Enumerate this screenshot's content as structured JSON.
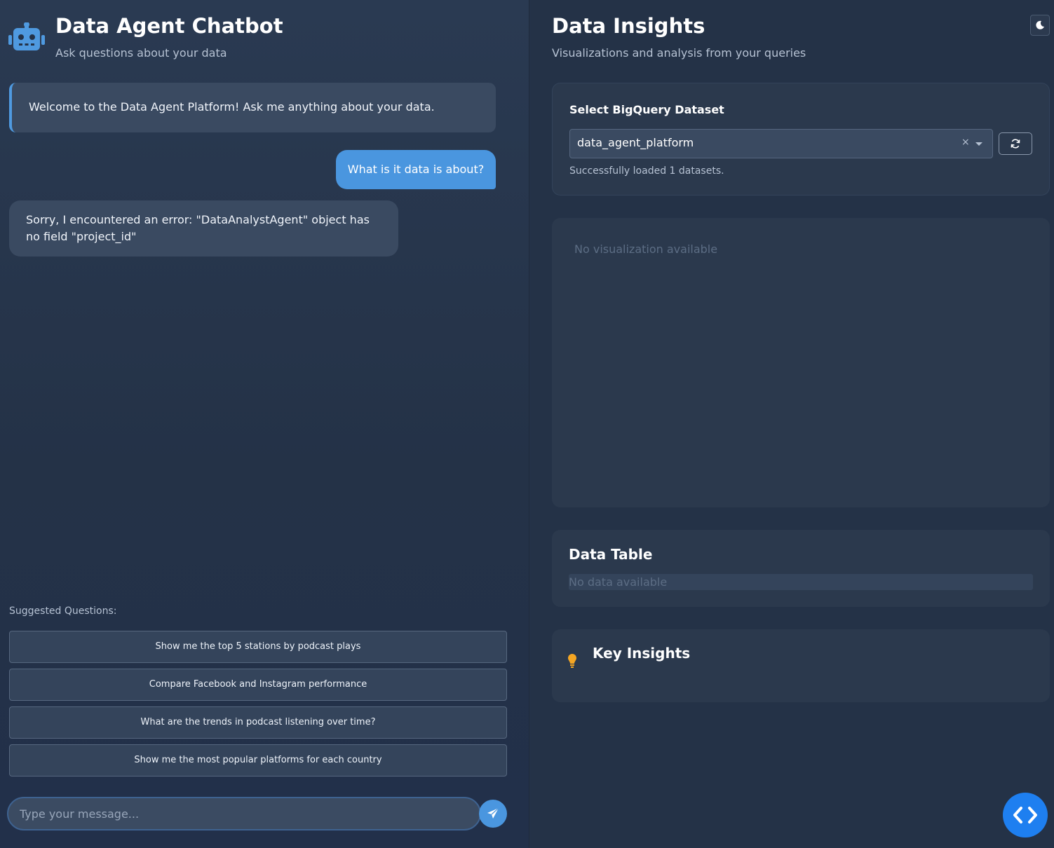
{
  "chat": {
    "title": "Data Agent Chatbot",
    "subtitle": "Ask questions about your data",
    "messages": [
      {
        "role": "bot",
        "text": "Welcome to the Data Agent Platform! Ask me anything about your data."
      },
      {
        "role": "user",
        "text": "What is it data is about?"
      },
      {
        "role": "bot",
        "text": "Sorry, I encountered an error: \"DataAnalystAgent\" object has no field \"project_id\""
      }
    ],
    "suggested_label": "Suggested Questions:",
    "suggestions": [
      "Show me the top 5 stations by podcast plays",
      "Compare Facebook and Instagram performance",
      "What are the trends in podcast listening over time?",
      "Show me the most popular platforms for each country"
    ],
    "input_placeholder": "Type your message..."
  },
  "insights": {
    "title": "Data Insights",
    "subtitle": "Visualizations and analysis from your queries",
    "dataset": {
      "label": "Select BigQuery Dataset",
      "selected": "data_agent_platform",
      "clear_symbol": "×",
      "status": "Successfully loaded 1 datasets."
    },
    "visualization_empty": "No visualization available",
    "table": {
      "title": "Data Table",
      "empty": "No data available"
    },
    "key_insights": {
      "title": "Key Insights"
    }
  },
  "icons": {
    "robot": "robot-icon",
    "send": "paper-plane-icon",
    "moon": "moon-icon",
    "refresh": "refresh-icon",
    "bulb": "lightbulb-icon",
    "code": "code-icon"
  },
  "colors": {
    "accent": "#4a96df",
    "fab": "#1e7ff0",
    "bulb": "#f5a623"
  }
}
